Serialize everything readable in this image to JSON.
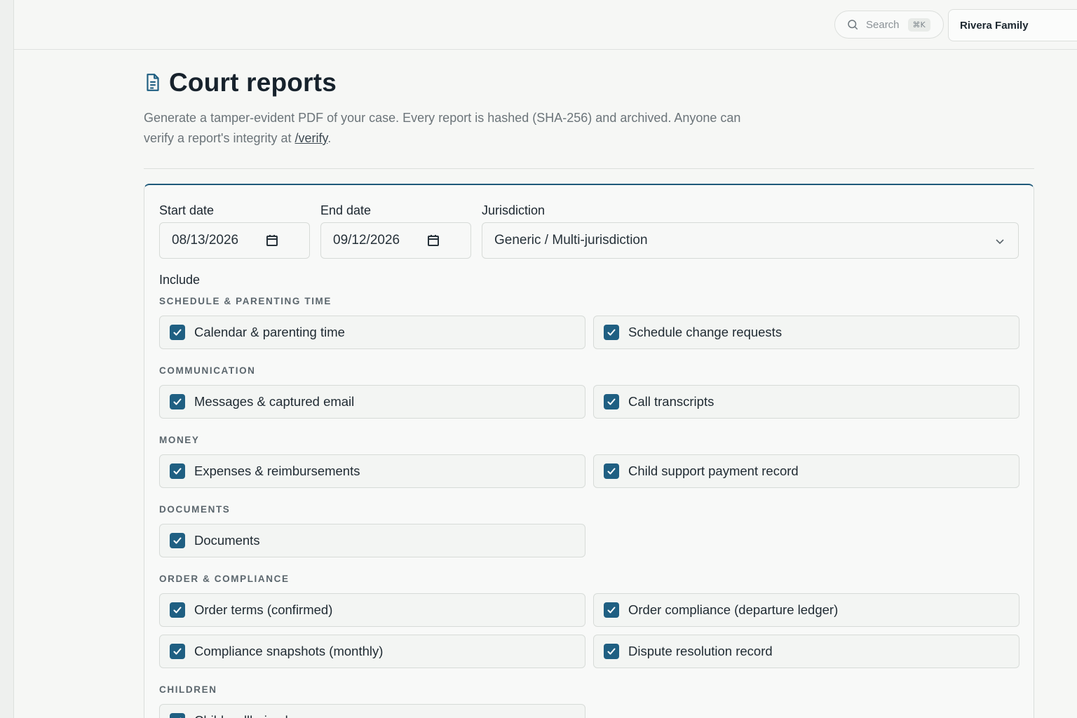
{
  "header": {
    "search_placeholder": "Search",
    "search_shortcut": "⌘K",
    "family_name": "Rivera Family"
  },
  "page": {
    "title": "Court reports",
    "description_prefix": "Generate a tamper-evident PDF of your case. Every report is hashed (SHA-256) and archived. Anyone can verify a report's integrity at ",
    "verify_link": "/verify",
    "description_suffix": "."
  },
  "form": {
    "start_date_label": "Start date",
    "start_date_value": "08/13/2026",
    "end_date_label": "End date",
    "end_date_value": "09/12/2026",
    "jurisdiction_label": "Jurisdiction",
    "jurisdiction_value": "Generic / Multi-jurisdiction",
    "include_label": "Include"
  },
  "sections": [
    {
      "title": "SCHEDULE & PARENTING TIME",
      "options": [
        {
          "label": "Calendar & parenting time",
          "checked": true
        },
        {
          "label": "Schedule change requests",
          "checked": true
        }
      ]
    },
    {
      "title": "COMMUNICATION",
      "options": [
        {
          "label": "Messages & captured email",
          "checked": true
        },
        {
          "label": "Call transcripts",
          "checked": true
        }
      ]
    },
    {
      "title": "MONEY",
      "options": [
        {
          "label": "Expenses & reimbursements",
          "checked": true
        },
        {
          "label": "Child support payment record",
          "checked": true
        }
      ]
    },
    {
      "title": "DOCUMENTS",
      "options": [
        {
          "label": "Documents",
          "checked": true
        }
      ]
    },
    {
      "title": "ORDER & COMPLIANCE",
      "options": [
        {
          "label": "Order terms (confirmed)",
          "checked": true
        },
        {
          "label": "Order compliance (departure ledger)",
          "checked": true
        },
        {
          "label": "Compliance snapshots (monthly)",
          "checked": true
        },
        {
          "label": "Dispute resolution record",
          "checked": true
        }
      ]
    },
    {
      "title": "CHILDREN",
      "options": [
        {
          "label": "Child wellbeing log",
          "checked": true
        }
      ]
    }
  ],
  "colors": {
    "accent": "#1f5f82",
    "background": "#f6f7f5"
  }
}
